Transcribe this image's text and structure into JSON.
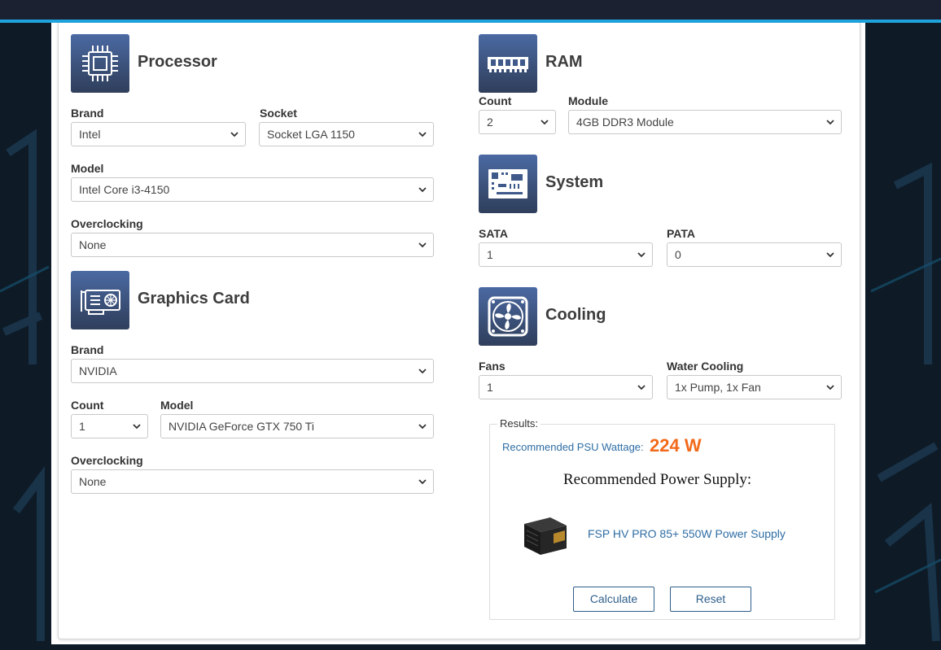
{
  "processor": {
    "title": "Processor",
    "icon": "cpu-icon",
    "brand_label": "Brand",
    "brand_value": "Intel",
    "socket_label": "Socket",
    "socket_value": "Socket LGA 1150",
    "model_label": "Model",
    "model_value": "Intel Core i3-4150",
    "oc_label": "Overclocking",
    "oc_value": "None"
  },
  "graphics": {
    "title": "Graphics Card",
    "icon": "graphics-card-icon",
    "brand_label": "Brand",
    "brand_value": "NVIDIA",
    "count_label": "Count",
    "count_value": "1",
    "model_label": "Model",
    "model_value": "NVIDIA GeForce GTX 750 Ti",
    "oc_label": "Overclocking",
    "oc_value": "None"
  },
  "ram": {
    "title": "RAM",
    "icon": "ram-icon",
    "count_label": "Count",
    "count_value": "2",
    "module_label": "Module",
    "module_value": "4GB DDR3 Module"
  },
  "system": {
    "title": "System",
    "icon": "motherboard-icon",
    "sata_label": "SATA",
    "sata_value": "1",
    "pata_label": "PATA",
    "pata_value": "0"
  },
  "cooling": {
    "title": "Cooling",
    "icon": "fan-icon",
    "fans_label": "Fans",
    "fans_value": "1",
    "water_label": "Water Cooling",
    "water_value": "1x Pump, 1x Fan"
  },
  "results": {
    "legend": "Results:",
    "wattage_label": "Recommended PSU Wattage:",
    "wattage_value": "224 W",
    "psu_heading": "Recommended Power Supply:",
    "psu_name": "FSP HV PRO 85+ 550W Power Supply",
    "psu_image": "power-supply-image",
    "calculate_label": "Calculate",
    "reset_label": "Reset"
  },
  "colors": {
    "accent": "#1fa3dd",
    "wattage": "#f26a1b",
    "link": "#2e6da4",
    "icon_bg": "#3f5a8a"
  }
}
